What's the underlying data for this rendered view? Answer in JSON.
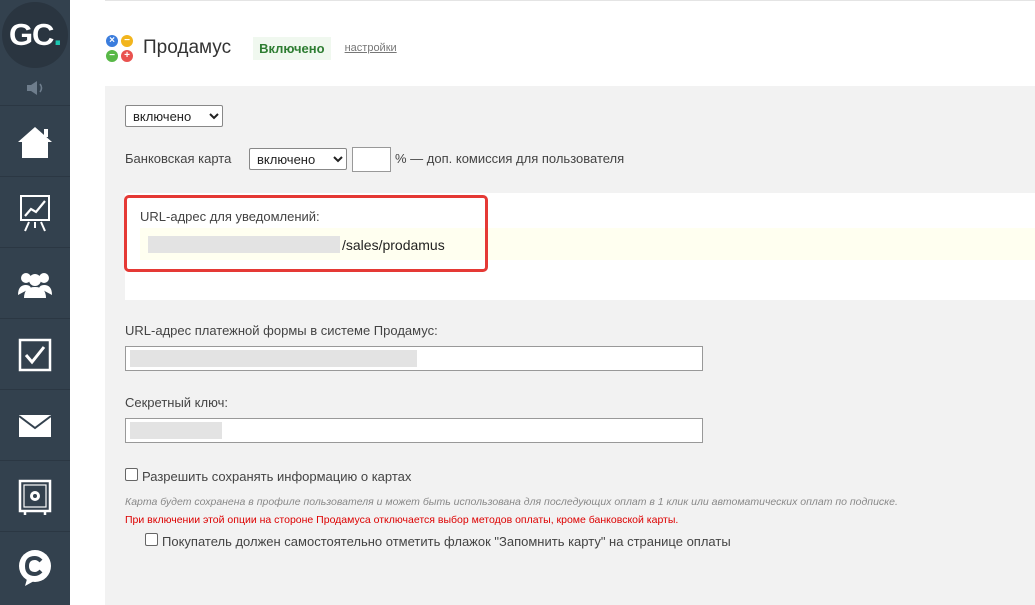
{
  "sidebar": {
    "logo_text": "GC",
    "logo_dot": ".",
    "accent_color": "#1cc6b0",
    "items": [
      {
        "icon": "speaker-icon"
      },
      {
        "icon": "home-icon"
      },
      {
        "icon": "chart-board-icon"
      },
      {
        "icon": "users-icon"
      },
      {
        "icon": "checkbox-icon"
      },
      {
        "icon": "mail-icon"
      },
      {
        "icon": "safe-icon"
      },
      {
        "icon": "chat-c-icon"
      }
    ]
  },
  "header": {
    "title": "Продамус",
    "status": "Включено",
    "settings_link": "настройки",
    "icon_signs": [
      "×",
      "−",
      "−",
      "+"
    ]
  },
  "form": {
    "main_select": {
      "selected": "включено"
    },
    "bank_card": {
      "label": "Банковская карта",
      "select": {
        "selected": "включено"
      },
      "percent_value": "",
      "commission_text": "% — доп. комиссия для пользователя"
    },
    "notify_url": {
      "label": "URL-адрес для уведомлений:",
      "value_suffix": "/sales/prodamus"
    },
    "payment_form_url": {
      "label": "URL-адрес платежной формы в системе Продамус:",
      "value": ""
    },
    "secret_key": {
      "label": "Секретный ключ:",
      "value": ""
    },
    "save_cards": {
      "label": "Разрешить сохранять информацию о картах",
      "checked": false,
      "hint": "Карта будет сохранена в профиле пользователя и может быть использована для последующих оплат в 1 клик или автоматических оплат по подписке.",
      "warning": "При включении этой опции на стороне Продамуса отключается выбор методов оплаты, кроме банковской карты."
    },
    "remember_card": {
      "label": "Покупатель должен самостоятельно отметить флажок \"Запомнить карту\" на странице оплаты",
      "checked": false
    }
  }
}
